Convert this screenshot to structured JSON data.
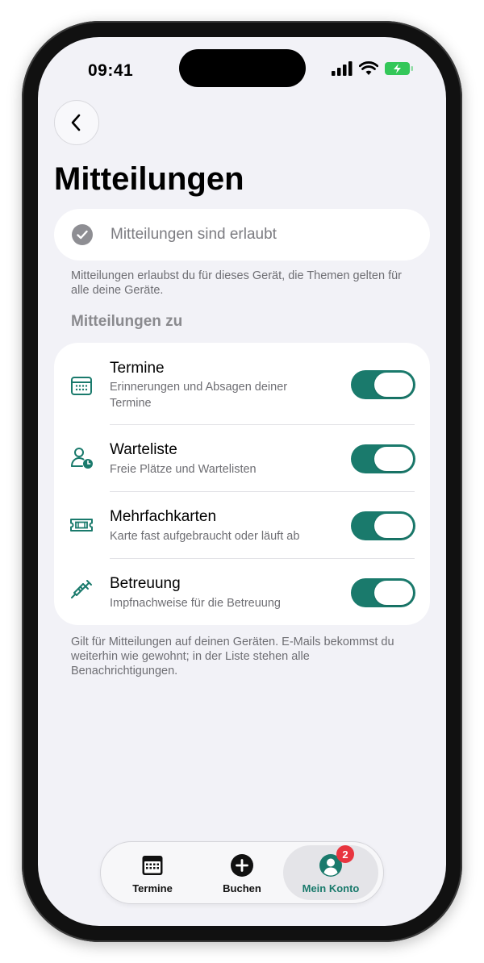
{
  "status_bar": {
    "time": "09:41"
  },
  "header": {
    "title": "Mitteilungen"
  },
  "permission": {
    "label": "Mitteilungen sind erlaubt"
  },
  "info_text": "Mitteilungen erlaubst du für dieses Gerät, die Themen gelten für alle deine Geräte.",
  "section_title": "Mitteilungen zu",
  "topics": [
    {
      "title": "Termine",
      "subtitle": "Erinnerungen und Absagen deiner Termine",
      "icon": "calendar-icon",
      "enabled": true
    },
    {
      "title": "Warteliste",
      "subtitle": "Freie Plätze und Wartelisten",
      "icon": "person-clock-icon",
      "enabled": true
    },
    {
      "title": "Mehrfachkarten",
      "subtitle": "Karte fast aufgebraucht oder läuft ab",
      "icon": "ticket-icon",
      "enabled": true
    },
    {
      "title": "Betreuung",
      "subtitle": "Impfnachweise für die Betreuung",
      "icon": "syringe-icon",
      "enabled": true
    }
  ],
  "footer_text": "Gilt für Mitteilungen auf deinen Geräten. E-Mails bekommst du weiterhin wie gewohnt; in der Liste stehen alle Benachrichtigungen.",
  "tabbar": {
    "tabs": [
      {
        "label": "Termine",
        "icon": "calendar-icon"
      },
      {
        "label": "Buchen",
        "icon": "plus-circle-icon"
      },
      {
        "label": "Mein Konto",
        "icon": "account-icon",
        "badge": "2",
        "active": true
      }
    ]
  },
  "colors": {
    "accent": "#1a7a6c",
    "badge": "#e8353f",
    "background": "#f2f2f7"
  }
}
